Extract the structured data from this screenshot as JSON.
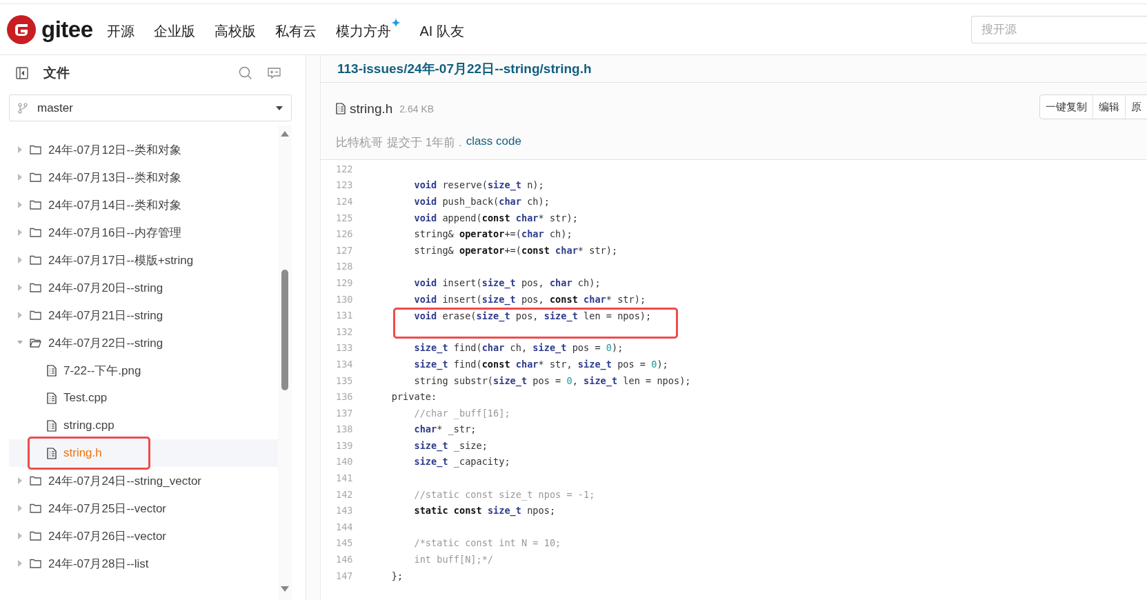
{
  "header": {
    "logo_text": "gitee",
    "nav": [
      {
        "label": "开源",
        "sparkle": false
      },
      {
        "label": "企业版",
        "sparkle": false
      },
      {
        "label": "高校版",
        "sparkle": false
      },
      {
        "label": "私有云",
        "sparkle": false
      },
      {
        "label": "模力方舟",
        "sparkle": true
      },
      {
        "label": "AI 队友",
        "sparkle": false
      }
    ],
    "search": {
      "placeholder": "搜开源"
    }
  },
  "sidebar": {
    "title": "文件",
    "branch": "master",
    "tree": [
      {
        "kind": "folder",
        "name": "24年-07月12日--类和对象",
        "expanded": false,
        "selected": false,
        "boxed": false
      },
      {
        "kind": "folder",
        "name": "24年-07月13日--类和对象",
        "expanded": false,
        "selected": false,
        "boxed": false
      },
      {
        "kind": "folder",
        "name": "24年-07月14日--类和对象",
        "expanded": false,
        "selected": false,
        "boxed": false
      },
      {
        "kind": "folder",
        "name": "24年-07月16日--内存管理",
        "expanded": false,
        "selected": false,
        "boxed": false
      },
      {
        "kind": "folder",
        "name": "24年-07月17日--模版+string",
        "expanded": false,
        "selected": false,
        "boxed": false
      },
      {
        "kind": "folder",
        "name": "24年-07月20日--string",
        "expanded": false,
        "selected": false,
        "boxed": false
      },
      {
        "kind": "folder",
        "name": "24年-07月21日--string",
        "expanded": false,
        "selected": false,
        "boxed": false
      },
      {
        "kind": "folder",
        "name": "24年-07月22日--string",
        "expanded": true,
        "selected": false,
        "boxed": false,
        "children": [
          {
            "kind": "file",
            "name": "7-22--下午.png",
            "selected": false,
            "boxed": false
          },
          {
            "kind": "file",
            "name": "Test.cpp",
            "selected": false,
            "boxed": false
          },
          {
            "kind": "file",
            "name": "string.cpp",
            "selected": false,
            "boxed": false
          },
          {
            "kind": "file",
            "name": "string.h",
            "selected": true,
            "boxed": true
          }
        ]
      },
      {
        "kind": "folder",
        "name": "24年-07月24日--string_vector",
        "expanded": false,
        "selected": false,
        "boxed": false
      },
      {
        "kind": "folder",
        "name": "24年-07月25日--vector",
        "expanded": false,
        "selected": false,
        "boxed": false
      },
      {
        "kind": "folder",
        "name": "24年-07月26日--vector",
        "expanded": false,
        "selected": false,
        "boxed": false
      },
      {
        "kind": "folder",
        "name": "24年-07月28日--list",
        "expanded": false,
        "selected": false,
        "boxed": false
      }
    ]
  },
  "file": {
    "path": "113-issues/24年-07月22日--string/string.h",
    "name": "string.h",
    "size": "2.64 KB",
    "buttons": [
      "一键复制",
      "编辑",
      "原"
    ],
    "commit": {
      "author": "比特杭哥",
      "action": "提交于 1年前 .",
      "message": "class code"
    }
  },
  "code": [
    {
      "number": "122",
      "boxed": false
    },
    {
      "number": "123",
      "boxed": false,
      "tokens": [
        {
          "kind": "type",
          "text": "        void"
        },
        {
          "kind": "plain",
          "text": " reserve("
        },
        {
          "kind": "type",
          "text": "size_t"
        },
        {
          "kind": "plain",
          "text": " n);"
        }
      ]
    },
    {
      "number": "124",
      "boxed": false,
      "tokens": [
        {
          "kind": "type",
          "text": "        void"
        },
        {
          "kind": "plain",
          "text": " push_back("
        },
        {
          "kind": "type",
          "text": "char"
        },
        {
          "kind": "plain",
          "text": " ch);"
        }
      ]
    },
    {
      "number": "125",
      "boxed": false,
      "tokens": [
        {
          "kind": "type",
          "text": "        void"
        },
        {
          "kind": "plain",
          "text": " append("
        },
        {
          "kind": "keyword",
          "text": "const "
        },
        {
          "kind": "type",
          "text": "char"
        },
        {
          "kind": "plain",
          "text": "* str);"
        }
      ]
    },
    {
      "number": "126",
      "boxed": false,
      "tokens": [
        {
          "kind": "plain",
          "text": "        string& "
        },
        {
          "kind": "keyword",
          "text": "operator"
        },
        {
          "kind": "plain",
          "text": "+=("
        },
        {
          "kind": "type",
          "text": "char"
        },
        {
          "kind": "plain",
          "text": " ch);"
        }
      ]
    },
    {
      "number": "127",
      "boxed": false,
      "tokens": [
        {
          "kind": "plain",
          "text": "        string& "
        },
        {
          "kind": "keyword",
          "text": "operator"
        },
        {
          "kind": "plain",
          "text": "+=("
        },
        {
          "kind": "keyword",
          "text": "const "
        },
        {
          "kind": "type",
          "text": "char"
        },
        {
          "kind": "plain",
          "text": "* str);"
        }
      ]
    },
    {
      "number": "128",
      "boxed": false
    },
    {
      "number": "129",
      "boxed": false,
      "tokens": [
        {
          "kind": "type",
          "text": "        void"
        },
        {
          "kind": "plain",
          "text": " insert("
        },
        {
          "kind": "type",
          "text": "size_t"
        },
        {
          "kind": "plain",
          "text": " pos, "
        },
        {
          "kind": "type",
          "text": "char"
        },
        {
          "kind": "plain",
          "text": " ch);"
        }
      ]
    },
    {
      "number": "130",
      "boxed": false,
      "tokens": [
        {
          "kind": "type",
          "text": "        void"
        },
        {
          "kind": "plain",
          "text": " insert("
        },
        {
          "kind": "type",
          "text": "size_t"
        },
        {
          "kind": "plain",
          "text": " pos, "
        },
        {
          "kind": "keyword",
          "text": "const "
        },
        {
          "kind": "type",
          "text": "char"
        },
        {
          "kind": "plain",
          "text": "* str);"
        }
      ]
    },
    {
      "number": "131",
      "boxed": true,
      "tokens": [
        {
          "kind": "type",
          "text": "        void"
        },
        {
          "kind": "plain",
          "text": " erase("
        },
        {
          "kind": "type",
          "text": "size_t"
        },
        {
          "kind": "plain",
          "text": " pos, "
        },
        {
          "kind": "type",
          "text": "size_t"
        },
        {
          "kind": "plain",
          "text": " len = npos);"
        }
      ]
    },
    {
      "number": "132",
      "boxed": false
    },
    {
      "number": "133",
      "boxed": false,
      "tokens": [
        {
          "kind": "type",
          "text": "        size_t"
        },
        {
          "kind": "plain",
          "text": " find("
        },
        {
          "kind": "type",
          "text": "char"
        },
        {
          "kind": "plain",
          "text": " ch, "
        },
        {
          "kind": "type",
          "text": "size_t"
        },
        {
          "kind": "plain",
          "text": " pos = "
        },
        {
          "kind": "number",
          "text": "0"
        },
        {
          "kind": "plain",
          "text": ");"
        }
      ]
    },
    {
      "number": "134",
      "boxed": false,
      "tokens": [
        {
          "kind": "type",
          "text": "        size_t"
        },
        {
          "kind": "plain",
          "text": " find("
        },
        {
          "kind": "keyword",
          "text": "const "
        },
        {
          "kind": "type",
          "text": "char"
        },
        {
          "kind": "plain",
          "text": "* str, "
        },
        {
          "kind": "type",
          "text": "size_t"
        },
        {
          "kind": "plain",
          "text": " pos = "
        },
        {
          "kind": "number",
          "text": "0"
        },
        {
          "kind": "plain",
          "text": ");"
        }
      ]
    },
    {
      "number": "135",
      "boxed": false,
      "tokens": [
        {
          "kind": "plain",
          "text": "        string substr("
        },
        {
          "kind": "type",
          "text": "size_t"
        },
        {
          "kind": "plain",
          "text": " pos = "
        },
        {
          "kind": "number",
          "text": "0"
        },
        {
          "kind": "plain",
          "text": ", "
        },
        {
          "kind": "type",
          "text": "size_t"
        },
        {
          "kind": "plain",
          "text": " len = npos);"
        }
      ]
    },
    {
      "number": "136",
      "boxed": false,
      "tokens": [
        {
          "kind": "plain",
          "text": "    private:"
        }
      ]
    },
    {
      "number": "137",
      "boxed": false,
      "tokens": [
        {
          "kind": "comment",
          "text": "        //char _buff[16];"
        }
      ]
    },
    {
      "number": "138",
      "boxed": false,
      "tokens": [
        {
          "kind": "type",
          "text": "        char"
        },
        {
          "kind": "plain",
          "text": "* _str;"
        }
      ]
    },
    {
      "number": "139",
      "boxed": false,
      "tokens": [
        {
          "kind": "type",
          "text": "        size_t"
        },
        {
          "kind": "plain",
          "text": " _size;"
        }
      ]
    },
    {
      "number": "140",
      "boxed": false,
      "tokens": [
        {
          "kind": "type",
          "text": "        size_t"
        },
        {
          "kind": "plain",
          "text": " _capacity;"
        }
      ]
    },
    {
      "number": "141",
      "boxed": false
    },
    {
      "number": "142",
      "boxed": false,
      "tokens": [
        {
          "kind": "comment",
          "text": "        //static const size_t npos = -1;"
        }
      ]
    },
    {
      "number": "143",
      "boxed": false,
      "tokens": [
        {
          "kind": "keyword",
          "text": "        static const "
        },
        {
          "kind": "type",
          "text": "size_t"
        },
        {
          "kind": "plain",
          "text": " npos;"
        }
      ]
    },
    {
      "number": "144",
      "boxed": false
    },
    {
      "number": "145",
      "boxed": false,
      "tokens": [
        {
          "kind": "comment",
          "text": "        /*static const int N = 10;"
        }
      ]
    },
    {
      "number": "146",
      "boxed": false,
      "tokens": [
        {
          "kind": "comment",
          "text": "        int buff[N];*/"
        }
      ]
    },
    {
      "number": "147",
      "boxed": false,
      "tokens": [
        {
          "kind": "plain",
          "text": "    };"
        }
      ]
    }
  ]
}
